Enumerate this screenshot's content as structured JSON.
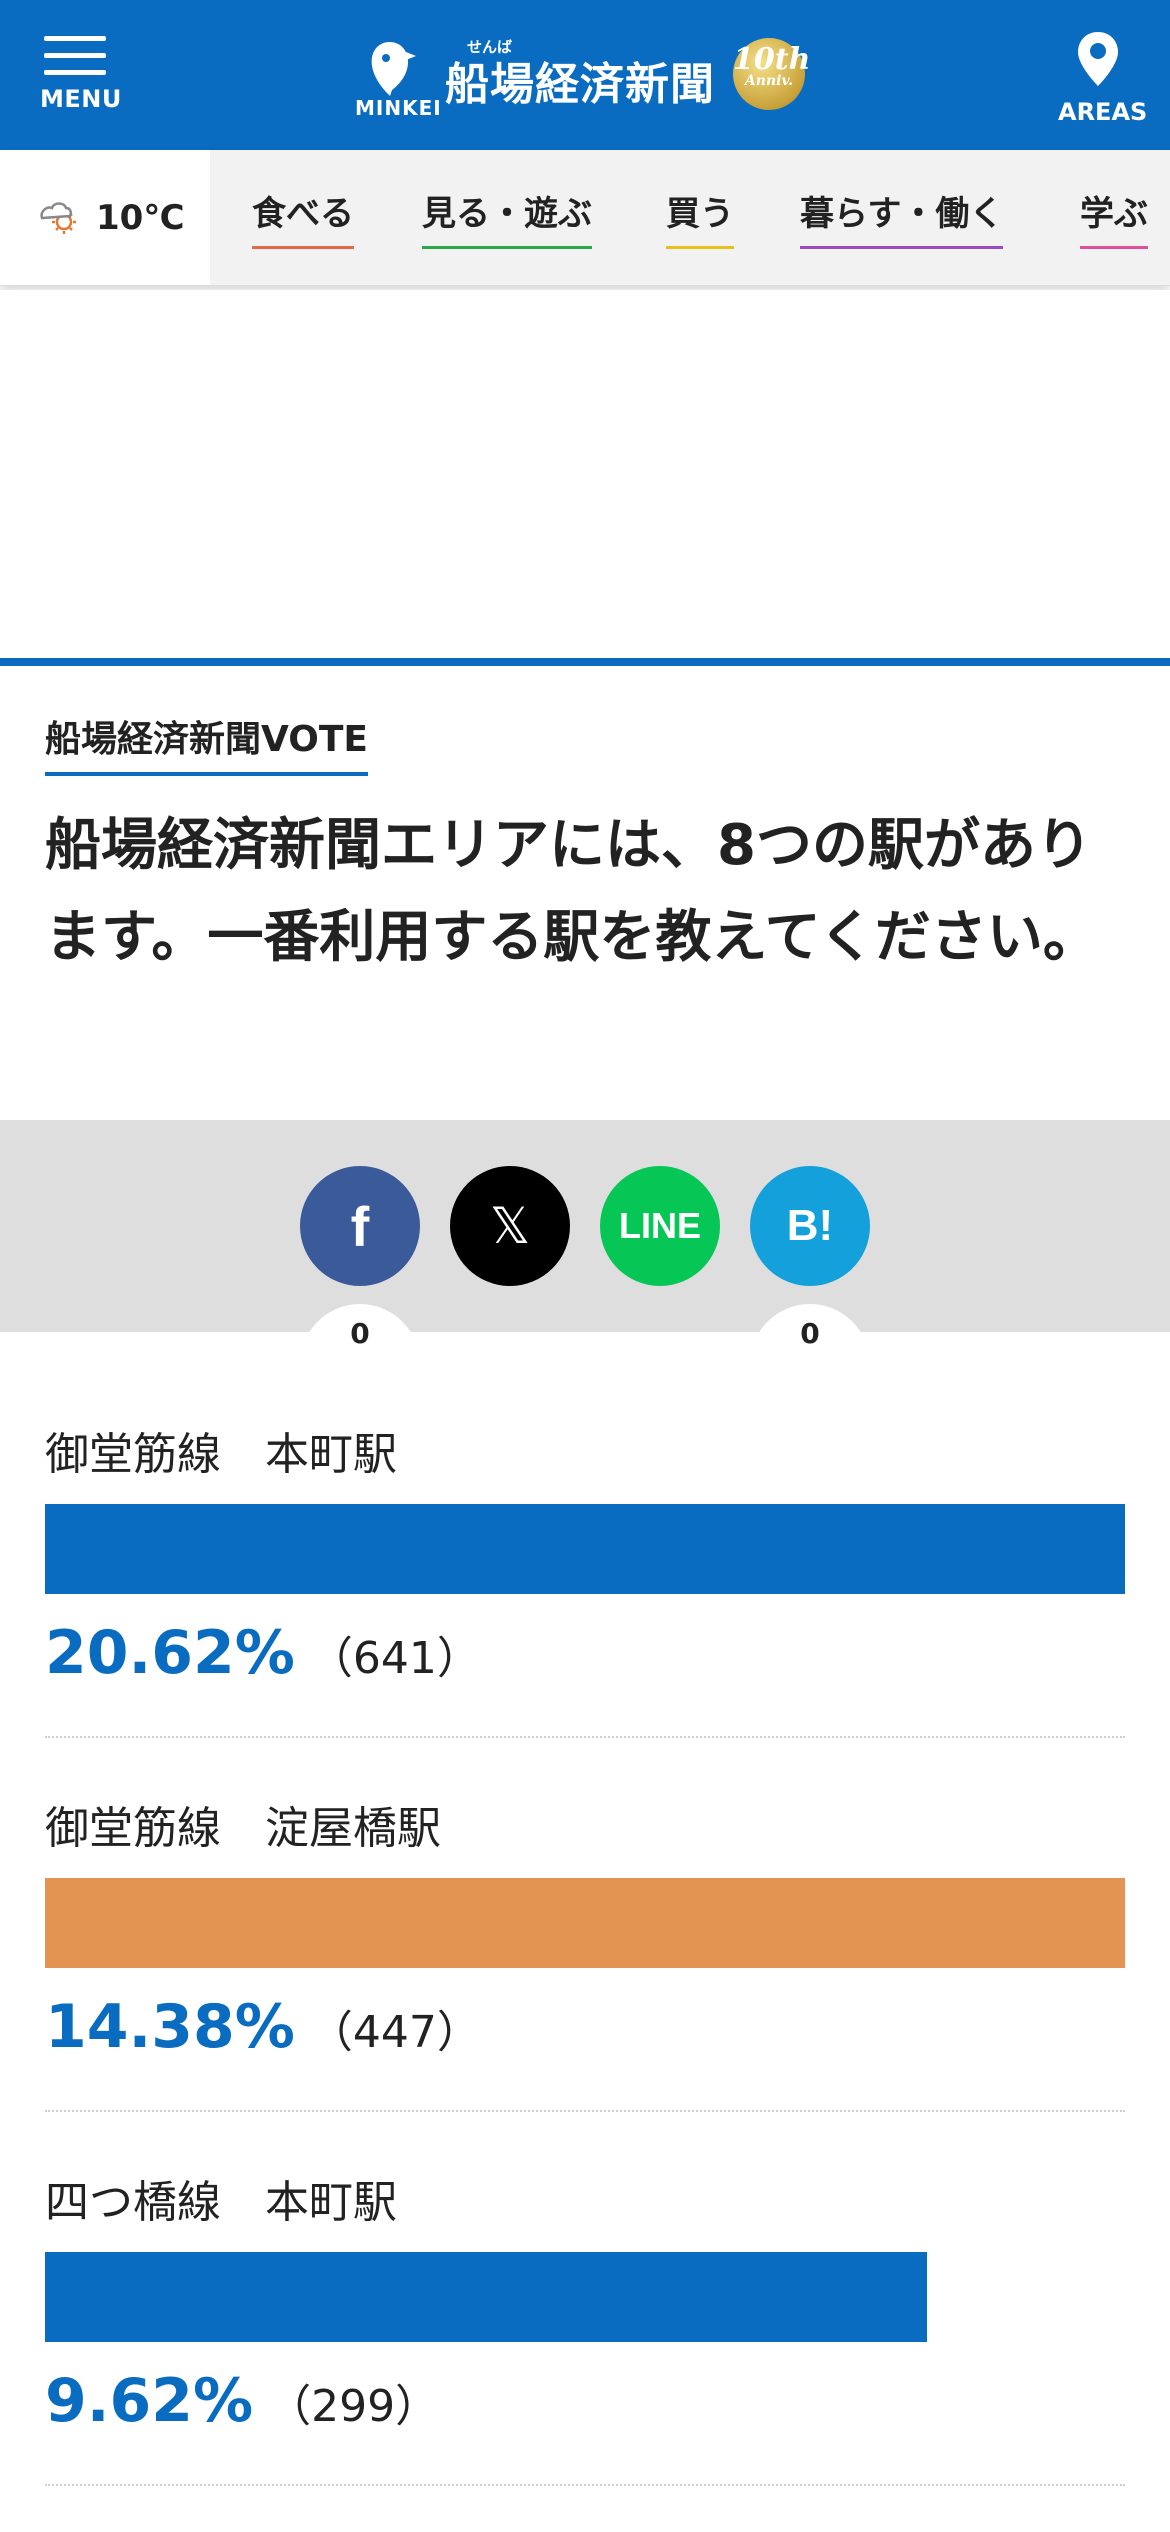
{
  "header": {
    "menu_label": "MENU",
    "areas_label": "AREAS",
    "logo_minkei": "MINKEI",
    "logo_ruby": "せんば",
    "logo_title": "船場経済新聞",
    "anniv_number": "10th",
    "anniv_text": "Anniv.",
    "bg_color": "#0a6cc0"
  },
  "weather": {
    "icon": "cloudy-sun-icon",
    "temp": "10℃"
  },
  "categories": [
    {
      "label": "食べる",
      "color": "#e06a4a"
    },
    {
      "label": "見る・遊ぶ",
      "color": "#2aa84a"
    },
    {
      "label": "買う",
      "color": "#e8c21a"
    },
    {
      "label": "暮らす・働く",
      "color": "#9b4ac0"
    },
    {
      "label": "学ぶ",
      "color": "#e0509a"
    }
  ],
  "vote": {
    "label": "船場経済新聞VOTE",
    "question": "船場経済新聞エリアには、8つの駅があります。一番利用する駅を教えてください。"
  },
  "share": {
    "facebook_label": "f",
    "x_label": "𝕏",
    "line_label": "LINE",
    "hatena_label": "B!",
    "facebook_count": "0",
    "hatena_count": "0"
  },
  "results": [
    {
      "name": "御堂筋線　本町駅",
      "percent_text": "20.62%",
      "count_text": "（641）",
      "bar_fraction": 1.0,
      "bar_color": "#0a6cc0"
    },
    {
      "name": "御堂筋線　淀屋橋駅",
      "percent_text": "14.38%",
      "count_text": "（447）",
      "bar_fraction": 1.0,
      "bar_color": "#e39452"
    },
    {
      "name": "四つ橋線　本町駅",
      "percent_text": "9.62%",
      "count_text": "（299）",
      "bar_fraction": 0.817,
      "bar_color": "#0a6cc0"
    }
  ]
}
